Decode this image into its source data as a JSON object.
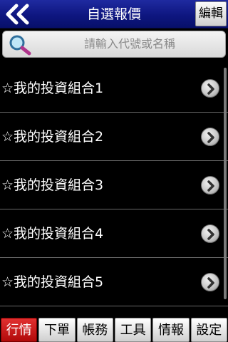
{
  "header": {
    "back_label": "<<",
    "title": "自選報價",
    "edit_label": "編輯"
  },
  "search": {
    "placeholder": "請輸入代號或名稱"
  },
  "list": {
    "items": [
      {
        "label": "☆我的投資組合1"
      },
      {
        "label": "☆我的投資組合2"
      },
      {
        "label": "☆我的投資組合3"
      },
      {
        "label": "☆我的投資組合4"
      },
      {
        "label": "☆我的投資組合5"
      }
    ]
  },
  "tabs": [
    {
      "label": "行情",
      "active": true
    },
    {
      "label": "下單",
      "active": false
    },
    {
      "label": "帳務",
      "active": false
    },
    {
      "label": "工具",
      "active": false
    },
    {
      "label": "情報",
      "active": false
    },
    {
      "label": "設定",
      "active": false
    }
  ],
  "colors": {
    "header_bg": "#0e1680",
    "active_tab": "#c41414",
    "background": "#000000"
  }
}
